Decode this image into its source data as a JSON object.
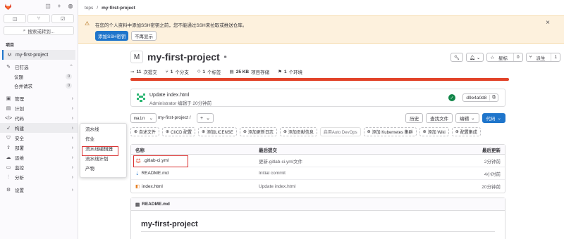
{
  "sidebar": {
    "section_label": "项目",
    "search_label": "搜索或转到...",
    "project": {
      "initial": "M",
      "name": "my-first-project"
    },
    "items": [
      {
        "name": "pinned",
        "label": "已钉选",
        "icon": "pin-icon"
      },
      {
        "name": "manage",
        "label": "管理",
        "icon": "briefcase-icon"
      },
      {
        "name": "plan",
        "label": "计划",
        "icon": "calendar-icon"
      },
      {
        "name": "code",
        "label": "代码",
        "icon": "code-icon"
      },
      {
        "name": "build",
        "label": "构建",
        "icon": "rocket-icon"
      },
      {
        "name": "secure",
        "label": "安全",
        "icon": "shield-icon"
      },
      {
        "name": "deploy",
        "label": "部署",
        "icon": "deploy-icon"
      },
      {
        "name": "operate",
        "label": "运维",
        "icon": "cloud-icon"
      },
      {
        "name": "monitor",
        "label": "监控",
        "icon": "monitor-icon"
      },
      {
        "name": "analyze",
        "label": "分析",
        "icon": "chart-icon"
      },
      {
        "name": "settings",
        "label": "设置",
        "icon": "gear-icon"
      }
    ],
    "pinned_sub": [
      {
        "label": "议题",
        "count": "0"
      },
      {
        "label": "合并请求",
        "count": "0"
      }
    ]
  },
  "breadcrumb": {
    "group": "tops",
    "project": "my-first-project"
  },
  "alert": {
    "message": "在您的个人资料中添加SSH密钥之前，您不能通过SSH来拉取或推送仓库。",
    "primary_button": "添加SSH密钥",
    "secondary_button": "不再显示"
  },
  "project": {
    "avatar": "M",
    "title": "my-first-project",
    "star_label": "星标",
    "star_count": "0",
    "fork_label": "派生",
    "fork_count": "1"
  },
  "stats": {
    "commits_num": "11",
    "commits_label": "次提交",
    "branches_num": "1",
    "branches_label": "个分支",
    "tags_num": "1",
    "tags_label": "个标签",
    "storage_num": "25 KB",
    "storage_label": "项目存储",
    "envs_num": "1",
    "envs_label": "个环境"
  },
  "progress_fraction": 1.0,
  "last_commit": {
    "message": "Update index.html",
    "author": "Administrator 编辑于 20分钟前",
    "sha": "d9e4a0d8"
  },
  "branch": {
    "name": "main",
    "path": "my-first-project",
    "separator": "/",
    "history": "历史",
    "find_file": "查找文件",
    "edit": "编辑",
    "code": "代码"
  },
  "quick_actions": [
    {
      "label": "自述文件",
      "style": "dashed"
    },
    {
      "label": "CI/CD 配置",
      "style": "dashed"
    },
    {
      "label": "添加LICENSE",
      "style": "dashed"
    },
    {
      "label": "添加更新日志",
      "style": "dashed"
    },
    {
      "label": "添加贡献信息",
      "style": "dashed"
    },
    {
      "label": "启用Auto DevOps",
      "style": "plain"
    },
    {
      "label": "添加 Kubernetes 集群",
      "style": "dashed"
    },
    {
      "label": "添加 Wiki",
      "style": "dashed"
    },
    {
      "label": "配置集成",
      "style": "dashed"
    }
  ],
  "files": {
    "headers": [
      "名称",
      "最后提交",
      "最后更新"
    ],
    "rows": [
      {
        "name": ".gitlab-ci.yml",
        "commit": "更新.gitlab-ci.yml文件",
        "updated": "2分钟前",
        "icon": "gitlab-icon"
      },
      {
        "name": "README.md",
        "commit": "Initial commit",
        "updated": "4小时前",
        "icon": "markdown-icon"
      },
      {
        "name": "index.html",
        "commit": "Update index.html",
        "updated": "20分钟前",
        "icon": "html-icon"
      }
    ]
  },
  "readme": {
    "filename": "README.md",
    "heading": "my-first-project"
  },
  "flyout": {
    "items": [
      "流水线",
      "作业",
      "流水线编辑器",
      "流水线计划",
      "产物"
    ]
  },
  "colors": {
    "accent": "#1f75cb",
    "brand": "#e24329",
    "highlight": "#d93131"
  }
}
